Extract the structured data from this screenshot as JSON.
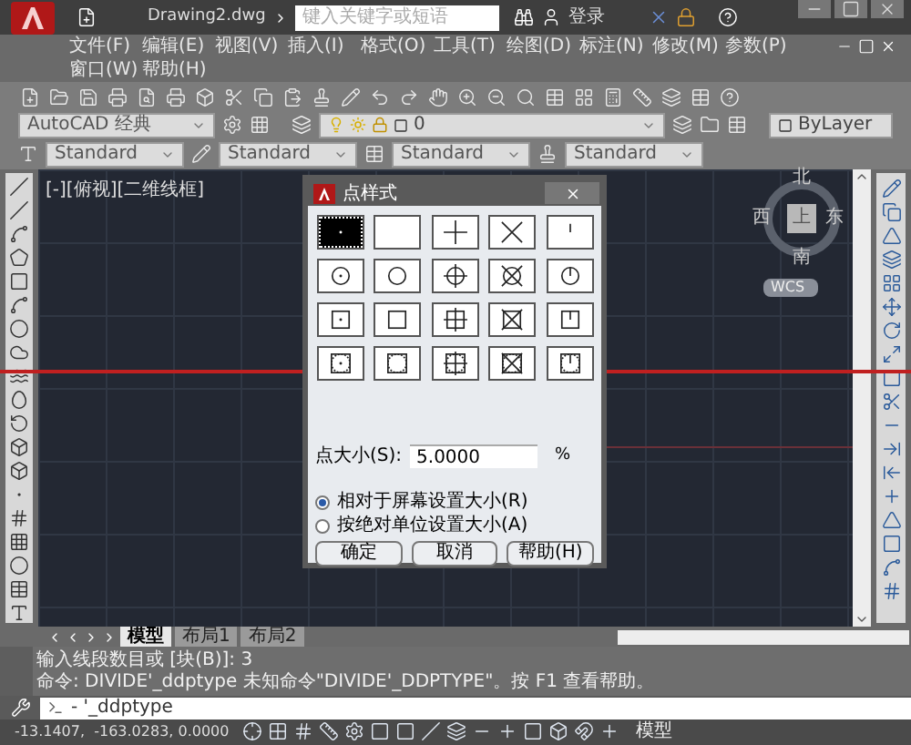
{
  "title_bar": {
    "file_name": "Drawing2.dwg",
    "search": {
      "placeholder": "键入关键字或短语"
    },
    "user": "登录"
  },
  "menu": [
    {
      "label": "文件(F)"
    },
    {
      "label": "编辑(E)"
    },
    {
      "label": "视图(V)"
    },
    {
      "label": "插入(I)"
    },
    {
      "label": "格式(O)"
    },
    {
      "label": "工具(T)"
    },
    {
      "label": "绘图(D)"
    },
    {
      "label": "标注(N)"
    },
    {
      "label": "修改(M)"
    },
    {
      "label": "参数(P)"
    },
    {
      "label": "窗口(W)"
    },
    {
      "label": "帮助(H)"
    }
  ],
  "workspace": "AutoCAD 经典",
  "layer": "0",
  "color_control": "ByLayer",
  "styles": [
    {
      "value": "Standard"
    },
    {
      "value": "Standard"
    },
    {
      "value": "Standard"
    },
    {
      "value": "Standard"
    }
  ],
  "viewport_label": "[-][俯视][二维线框]",
  "viewcube": {
    "top": "上",
    "north": "北",
    "south": "南",
    "east": "东",
    "west": "西",
    "ucs": "WCS"
  },
  "layout_tabs": [
    {
      "label": "模型",
      "selected": true
    },
    {
      "label": "布局1",
      "selected": false
    },
    {
      "label": "布局2",
      "selected": false
    }
  ],
  "command_history": [
    "输入线段数目或 [块(B)]: 3",
    "命令: DIVIDE'_ddptype 未知命令\"DIVIDE'_DDPTYPE\"。按 F1 查看帮助。"
  ],
  "command_input": "- '_ddptype",
  "status": {
    "coordinates": "-13.1407,  -163.0283, 0.0000",
    "model": "模型"
  },
  "dialog": {
    "title": "点样式",
    "point_styles": [
      {
        "kind": "dot",
        "circle": false,
        "square": false,
        "selected": true
      },
      {
        "kind": "none",
        "circle": false,
        "square": false,
        "selected": false
      },
      {
        "kind": "plus",
        "circle": false,
        "square": false,
        "selected": false
      },
      {
        "kind": "cross",
        "circle": false,
        "square": false,
        "selected": false
      },
      {
        "kind": "tick",
        "circle": false,
        "square": false,
        "selected": false
      },
      {
        "kind": "dot",
        "circle": true,
        "square": false,
        "selected": false
      },
      {
        "kind": "none",
        "circle": true,
        "square": false,
        "selected": false
      },
      {
        "kind": "plus",
        "circle": true,
        "square": false,
        "selected": false
      },
      {
        "kind": "cross",
        "circle": true,
        "square": false,
        "selected": false
      },
      {
        "kind": "tick",
        "circle": true,
        "square": false,
        "selected": false
      },
      {
        "kind": "dot",
        "circle": false,
        "square": true,
        "selected": false
      },
      {
        "kind": "none",
        "circle": false,
        "square": true,
        "selected": false
      },
      {
        "kind": "plus",
        "circle": false,
        "square": true,
        "selected": false
      },
      {
        "kind": "cross",
        "circle": false,
        "square": true,
        "selected": false
      },
      {
        "kind": "tick",
        "circle": false,
        "square": true,
        "selected": false
      },
      {
        "kind": "dot",
        "circle": true,
        "square": true,
        "selected": false
      },
      {
        "kind": "none",
        "circle": true,
        "square": true,
        "selected": false
      },
      {
        "kind": "plus",
        "circle": true,
        "square": true,
        "selected": false
      },
      {
        "kind": "cross",
        "circle": true,
        "square": true,
        "selected": false
      },
      {
        "kind": "tick",
        "circle": true,
        "square": true,
        "selected": false
      }
    ],
    "size_label": "点大小(S):",
    "size_value": "5.0000",
    "size_unit": "%",
    "size_modes": [
      {
        "label": "相对于屏幕设置大小(R)",
        "selected": true
      },
      {
        "label": "按绝对单位设置大小(A)",
        "selected": false
      }
    ],
    "buttons": [
      {
        "label": "确定"
      },
      {
        "label": "取消"
      },
      {
        "label": "帮助(H)"
      }
    ]
  }
}
